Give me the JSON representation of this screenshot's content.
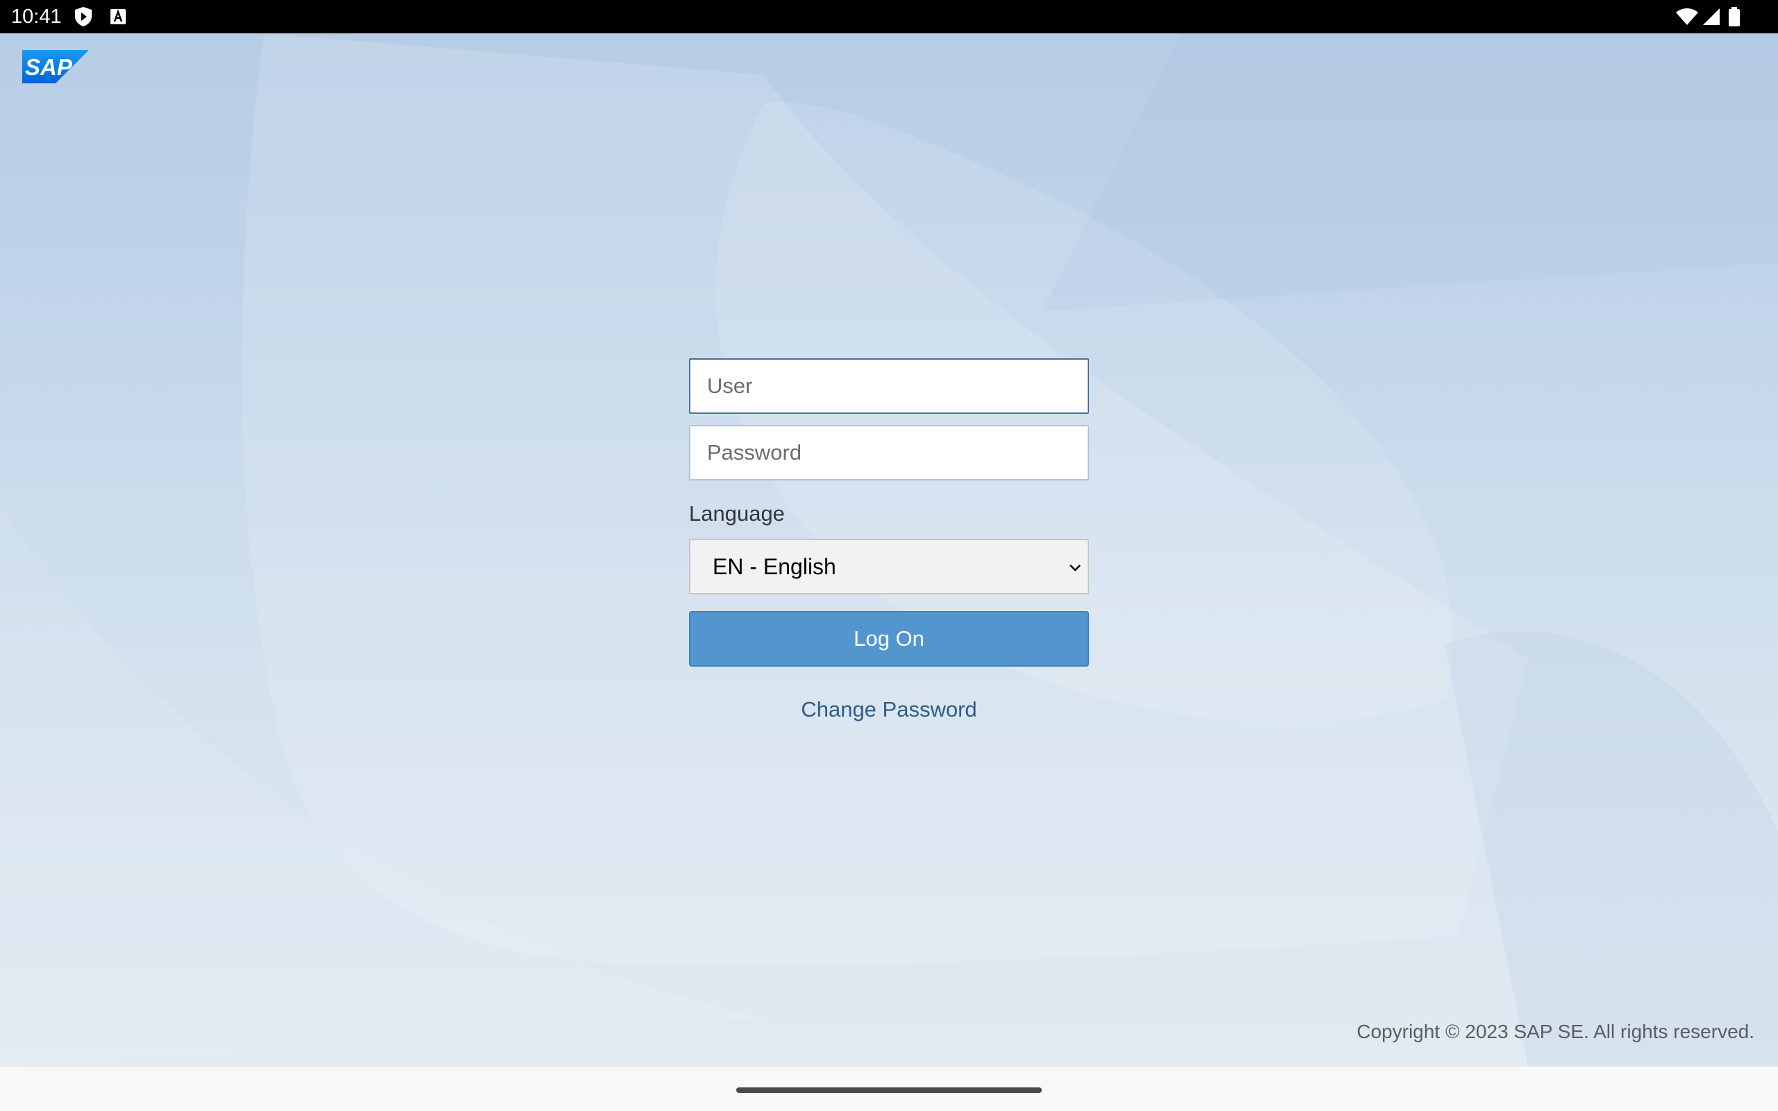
{
  "status_bar": {
    "time": "10:41",
    "icons": [
      "play-protect-icon",
      "a-notification-icon",
      "wifi-icon",
      "signal-icon",
      "battery-icon"
    ]
  },
  "logo": {
    "text": "SAP",
    "colors": {
      "primary": "#0070f2",
      "secondary": "#1a9af0"
    }
  },
  "login": {
    "user_placeholder": "User",
    "password_placeholder": "Password",
    "language_label": "Language",
    "language_value": "EN - English",
    "logon_label": "Log On",
    "change_password_label": "Change Password"
  },
  "footer": {
    "copyright": "Copyright © 2023 SAP SE. All rights reserved."
  },
  "colors": {
    "button": "#5396cf",
    "link": "#2e5c8a",
    "background": "#c3d6ea"
  }
}
